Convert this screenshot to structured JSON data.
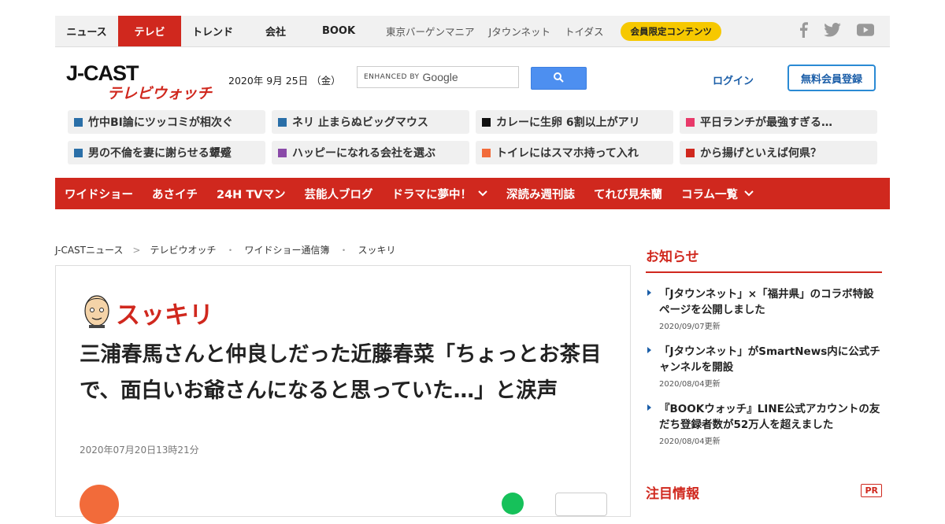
{
  "topnav": {
    "tabs": [
      {
        "label": "ニュース",
        "active": false
      },
      {
        "label": "テレビ",
        "active": true
      },
      {
        "label": "トレンド",
        "active": false
      },
      {
        "label": "会社",
        "active": false
      },
      {
        "label": "BOOK",
        "active": false
      }
    ],
    "sites": [
      "東京バーゲンマニア",
      "Jタウンネット",
      "トイダス"
    ],
    "member_label": "会員限定コンテンツ",
    "social_icons": [
      "facebook-icon",
      "twitter-icon",
      "youtube-icon"
    ]
  },
  "header": {
    "logo_main": "J-CAST",
    "logo_sub": "テレビウォッチ",
    "date": "2020年 9月 25日 （金）",
    "search_enhanced": "ENHANCED BY",
    "search_brand": "Google",
    "login_label": "ログイン",
    "register_label": "無料会員登録"
  },
  "trending": [
    {
      "text": "竹中BI論にツッコミが相次ぐ",
      "color": "#2a6fa8"
    },
    {
      "text": "ネリ 止まらぬビッグマウス",
      "color": "#2a6fa8"
    },
    {
      "text": "カレーに生卵 6割以上がアリ",
      "color": "#111111"
    },
    {
      "text": "平日ランチが最強すぎる…",
      "color": "#e83a6a"
    },
    {
      "text": "男の不倫を妻に謝らせる顰蹙",
      "color": "#2a6fa8"
    },
    {
      "text": "ハッピーになれる会社を選ぶ",
      "color": "#8a4aa8"
    },
    {
      "text": "トイレにはスマホ持って入れ",
      "color": "#f26b3a"
    },
    {
      "text": "から揚げといえば何県？",
      "color": "#d0281e"
    }
  ],
  "catnav": [
    {
      "label": "ワイドショー",
      "dropdown": false
    },
    {
      "label": "あさイチ",
      "dropdown": false
    },
    {
      "label": "24H TVマン",
      "dropdown": false
    },
    {
      "label": "芸能人ブログ",
      "dropdown": false
    },
    {
      "label": "ドラマに夢中！",
      "dropdown": true
    },
    {
      "label": "深読み週刊誌",
      "dropdown": false
    },
    {
      "label": "てれび見朱蘭",
      "dropdown": false
    },
    {
      "label": "コラム一覧",
      "dropdown": true
    }
  ],
  "breadcrumb": [
    "J-CASTニュース",
    "テレビウオッチ",
    "ワイドショー通信簿",
    "スッキリ"
  ],
  "article": {
    "program": "スッキリ",
    "title": "三浦春馬さんと仲良しだった近藤春菜「ちょっとお茶目で、面白いお爺さんになると思っていた…」と涙声",
    "published": "2020年07月20日13時21分"
  },
  "sidebar": {
    "heading": "お知らせ",
    "items": [
      {
        "title": "「Jタウンネット」×「福井県」のコラボ特設ページを公開しました",
        "date": "2020/09/07更新"
      },
      {
        "title": "「Jタウンネット」がSmartNews内に公式チャンネルを開設",
        "date": "2020/08/04更新"
      },
      {
        "title": "『BOOKウォッチ』LINE公式アカウントの友だち登録者数が52万人を超えました",
        "date": "2020/08/04更新"
      }
    ],
    "heading2": "注目情報",
    "pr_label": "PR"
  },
  "colors": {
    "brand_red": "#d0281e",
    "link_blue": "#1b5ea8",
    "member_yellow": "#f6c800"
  }
}
